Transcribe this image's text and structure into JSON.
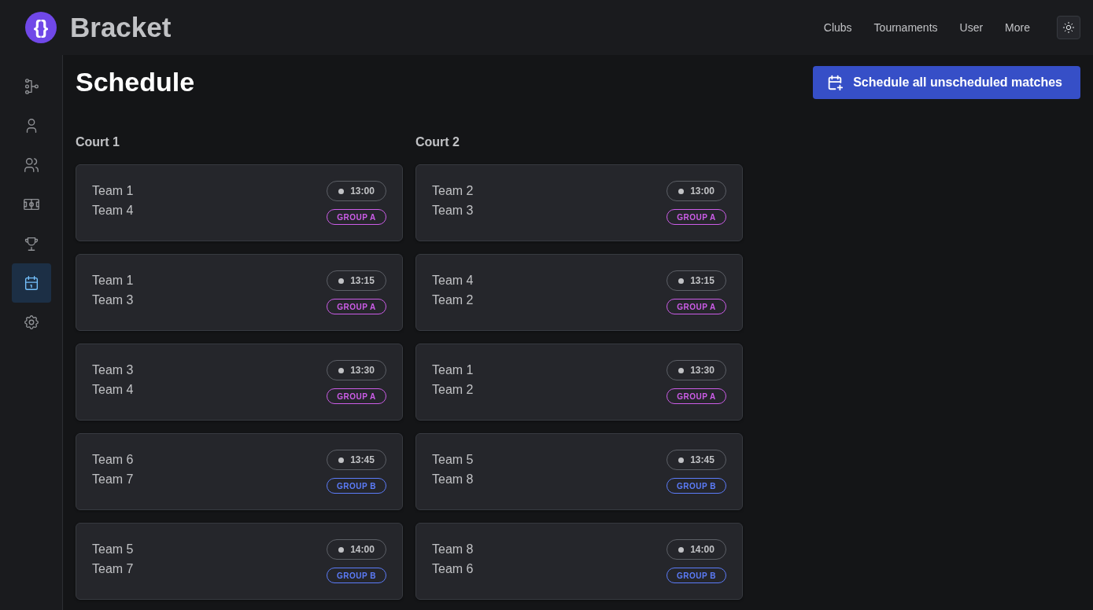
{
  "app": {
    "name": "Bracket",
    "logo_text": "{}"
  },
  "nav": [
    "Clubs",
    "Tournaments",
    "User",
    "More"
  ],
  "sidebar": {
    "items": [
      {
        "selected": false
      },
      {
        "selected": false
      },
      {
        "selected": false
      },
      {
        "selected": false
      },
      {
        "selected": false
      },
      {
        "selected": true
      },
      {
        "selected": false
      }
    ]
  },
  "page_title": "Schedule",
  "action_button": "Schedule all unscheduled matches",
  "courts": [
    {
      "name": "Court 1",
      "matches": [
        {
          "team_1": "Team 1",
          "team_2": "Team 4",
          "time": "13:00",
          "group": "GROUP A",
          "color": "#cc5de8"
        },
        {
          "team_1": "Team 1",
          "team_2": "Team 3",
          "time": "13:15",
          "group": "GROUP A",
          "color": "#cc5de8"
        },
        {
          "team_1": "Team 3",
          "team_2": "Team 4",
          "time": "13:30",
          "group": "GROUP A",
          "color": "#cc5de8"
        },
        {
          "team_1": "Team 6",
          "team_2": "Team 7",
          "time": "13:45",
          "group": "GROUP B",
          "color": "#5c7cfa"
        },
        {
          "team_1": "Team 5",
          "team_2": "Team 7",
          "time": "14:00",
          "group": "GROUP B",
          "color": "#5c7cfa"
        }
      ]
    },
    {
      "name": "Court 2",
      "matches": [
        {
          "team_1": "Team 2",
          "team_2": "Team 3",
          "time": "13:00",
          "group": "GROUP A",
          "color": "#cc5de8"
        },
        {
          "team_1": "Team 4",
          "team_2": "Team 2",
          "time": "13:15",
          "group": "GROUP A",
          "color": "#cc5de8"
        },
        {
          "team_1": "Team 1",
          "team_2": "Team 2",
          "time": "13:30",
          "group": "GROUP A",
          "color": "#cc5de8"
        },
        {
          "team_1": "Team 5",
          "team_2": "Team 8",
          "time": "13:45",
          "group": "GROUP B",
          "color": "#5c7cfa"
        },
        {
          "team_1": "Team 8",
          "team_2": "Team 6",
          "time": "14:00",
          "group": "GROUP B",
          "color": "#5c7cfa"
        }
      ]
    }
  ]
}
